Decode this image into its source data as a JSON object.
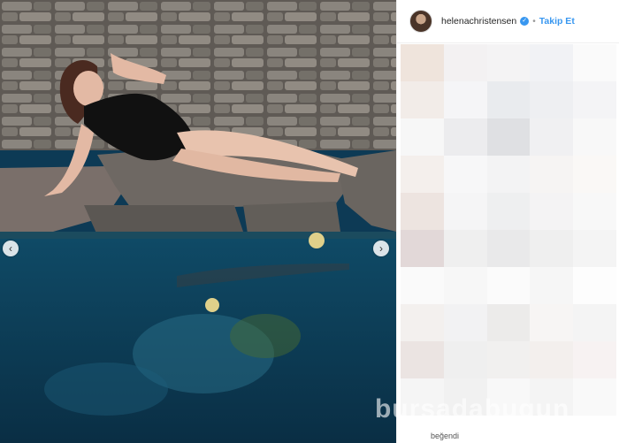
{
  "post": {
    "username": "helenachristensen",
    "verified_mark": "✓",
    "separator": "•",
    "follow_label": "Takip Et",
    "liked_text": "beğendi",
    "nav_prev": "‹",
    "nav_next": "›"
  },
  "watermark": "bursadabugun",
  "colors": {
    "follow_blue": "#3897f0",
    "pool_water": "#0d3a55",
    "stone": "#6e6863"
  },
  "icons": [
    "verified-badge-icon",
    "chevron-left-icon",
    "chevron-right-icon"
  ]
}
